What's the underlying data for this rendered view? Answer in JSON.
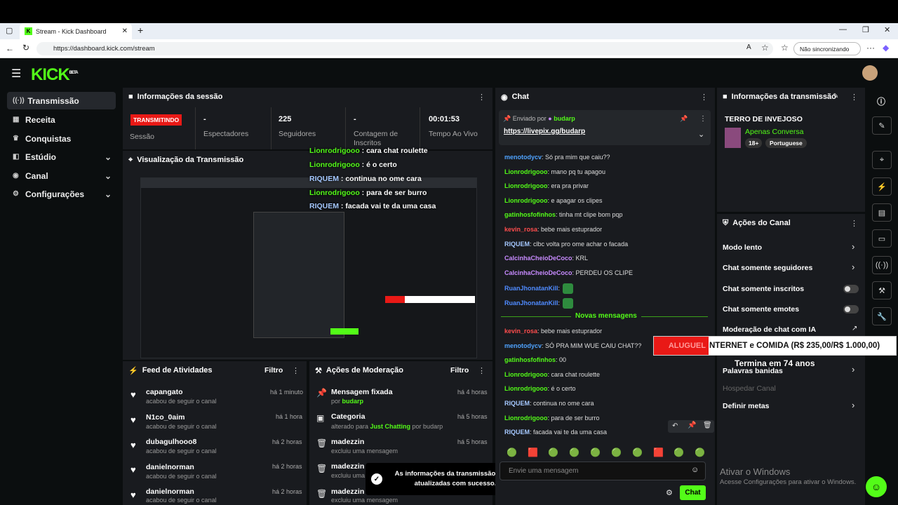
{
  "browser": {
    "tab_title": "Stream - Kick Dashboard",
    "url": "https://dashboard.kick.com/stream",
    "sync_label": "Não sincronizando"
  },
  "brand": {
    "logo": "KICK",
    "badge": "BETA"
  },
  "sidebar": {
    "items": [
      {
        "label": "Transmissão",
        "icon": "broadcast-icon"
      },
      {
        "label": "Receita",
        "icon": "revenue-icon"
      },
      {
        "label": "Conquistas",
        "icon": "trophy-icon"
      },
      {
        "label": "Estúdio",
        "icon": "studio-icon"
      },
      {
        "label": "Canal",
        "icon": "channel-icon"
      },
      {
        "label": "Configurações",
        "icon": "gear-icon"
      }
    ]
  },
  "session": {
    "title": "Informações da sessão",
    "badge": "TRANSMITINDO",
    "session_label": "Sessão",
    "viewers_value": "-",
    "viewers_label": "Espectadores",
    "followers_value": "225",
    "followers_label": "Seguidores",
    "subs_value": "-",
    "subs_label": "Contagem de Inscritos",
    "time_value": "00:01:53",
    "time_label": "Tempo Ao Vivo"
  },
  "preview": {
    "title": "Visualização da Transmissão"
  },
  "overlay": [
    {
      "user": "Lionrodrigooo",
      "msg": " : cara chat roulette"
    },
    {
      "user": "Lionrodrigooo",
      "msg": " : é o certo"
    },
    {
      "user": "RIQUEM",
      "msg": " : continua no ome cara"
    },
    {
      "user": "Lionrodrigooo",
      "msg": " : para de ser burro"
    },
    {
      "user": "RIQUEM",
      "msg": " : facada vai te da uma casa"
    }
  ],
  "chat": {
    "title": "Chat",
    "pinned_by": "Enviado por",
    "pinned_user": "budarp",
    "pinned_link": "https://livepix.gg/budarp",
    "messages": [
      {
        "user": "menotodycv",
        "msg": ": Só pra mim que caiu??",
        "color": "#4fa3ff"
      },
      {
        "user": "Lionrodrigooo",
        "msg": ": mano pq tu apagou",
        "color": "#53fc18"
      },
      {
        "user": "Lionrodrigooo",
        "msg": ": era pra privar",
        "color": "#53fc18"
      },
      {
        "user": "Lionrodrigooo",
        "msg": ": e apagar os clipes",
        "color": "#53fc18"
      },
      {
        "user": "gatinhosfofinhos",
        "msg": ": tinha mt clipe bom pqp",
        "color": "#53fc18"
      },
      {
        "user": "kevin_rosa",
        "msg": ": bebe mais estuprador",
        "color": "#ff4d4d"
      },
      {
        "user": "RIQUEM",
        "msg": ": clbc volta pro ome achar o facada",
        "color": "#a5c8ff"
      },
      {
        "user": "CalcinhaCheioDeCoco",
        "msg": ": KRL",
        "color": "#c88bff"
      },
      {
        "user": "CalcinhaCheioDeCoco",
        "msg": ": PERDEU OS CLIPE",
        "color": "#c88bff"
      },
      {
        "user": "RuanJhonatanKill",
        "msg": ":",
        "color": "#4f8bff"
      },
      {
        "user": "RuanJhonatanKill",
        "msg": ":",
        "color": "#4f8bff"
      }
    ],
    "new_label": "Novas mensagens",
    "new_messages": [
      {
        "user": "kevin_rosa",
        "msg": ": bebe mais estuprador",
        "color": "#ff4d4d"
      },
      {
        "user": "menotodycv",
        "msg": ": SÓ PRA MIM WUE CAIU CHAT??",
        "color": "#4fa3ff"
      },
      {
        "user": "gatinhosfofinhos",
        "msg": ": 00",
        "color": "#53fc18"
      },
      {
        "user": "Lionrodrigooo",
        "msg": ": cara chat roulette",
        "color": "#53fc18"
      },
      {
        "user": "Lionrodrigooo",
        "msg": ": é o certo",
        "color": "#53fc18"
      },
      {
        "user": "RIQUEM",
        "msg": ": continua no ome cara",
        "color": "#a5c8ff"
      },
      {
        "user": "Lionrodrigooo",
        "msg": ": para de ser burro",
        "color": "#53fc18"
      },
      {
        "user": "RIQUEM",
        "msg": ": facada vai te da uma casa",
        "color": "#a5c8ff"
      }
    ],
    "input_placeholder": "Envie uma mensagem",
    "send_label": "Chat"
  },
  "streaminfo": {
    "title": "Informações da transmissão",
    "stream_title": "TERRO DE INVEJOSO",
    "category": "Apenas Conversa",
    "tag1": "18+",
    "tag2": "Portuguese"
  },
  "actions": {
    "title": "Ações do Canal",
    "slow": "Modo lento",
    "followers_only": "Chat somente seguidores",
    "subs_only": "Chat somente inscritos",
    "emotes_only": "Chat somente emotes",
    "ai_mod": "Moderação de chat com IA",
    "banned": "Palavras banidas",
    "host": "Hospedar Canal",
    "goals": "Definir metas"
  },
  "banner": {
    "red_text": "ALUGUEL",
    "white_text": "NTERNET e COMIDA (R$ 235,00/R$ 1.000,00)",
    "ends": "Termina em 74 anos"
  },
  "feed": {
    "title": "Feed de Atividades",
    "filter": "Filtro",
    "items": [
      {
        "user": "capangato",
        "sub": "acabou de seguir o canal",
        "time": "há 1 minuto"
      },
      {
        "user": "N1co_0aim",
        "sub": "acabou de seguir o canal",
        "time": "há 1 hora"
      },
      {
        "user": "dubagulhooo8",
        "sub": "acabou de seguir o canal",
        "time": "há 2 horas"
      },
      {
        "user": "danielnorman",
        "sub": "acabou de seguir o canal",
        "time": "há 2 horas"
      },
      {
        "user": "danielnorman",
        "sub": "acabou de seguir o canal",
        "time": "há 2 horas"
      }
    ]
  },
  "mod": {
    "title": "Ações de Moderação",
    "filter": "Filtro",
    "items": [
      {
        "title": "Mensagem fixada",
        "pre": "por ",
        "hl": "budarp",
        "post": "",
        "time": "há 4 horas"
      },
      {
        "title": "Categoria",
        "pre": "alterado para ",
        "hl": "Just Chatting",
        "post": " por budarp",
        "time": "há 5 horas"
      },
      {
        "title": "madezzin",
        "pre": "excluiu uma mensagem",
        "hl": "",
        "post": "",
        "time": "há 5 horas"
      },
      {
        "title": "madezzin",
        "pre": "excluiu uma mensagem",
        "hl": "",
        "post": "",
        "time": ""
      },
      {
        "title": "madezzin",
        "pre": "excluiu uma mensagem",
        "hl": "",
        "post": "",
        "time": ""
      }
    ]
  },
  "toast": {
    "text": "As informações da transmissão foram atualizadas com sucesso."
  },
  "windows": {
    "title": "Ativar o Windows",
    "sub": "Acesse Configurações para ativar o Windows."
  },
  "colors": {
    "accent": "#53fc18",
    "live": "#e91916",
    "panel": "#191b1f",
    "bg": "#0b0e0f"
  }
}
